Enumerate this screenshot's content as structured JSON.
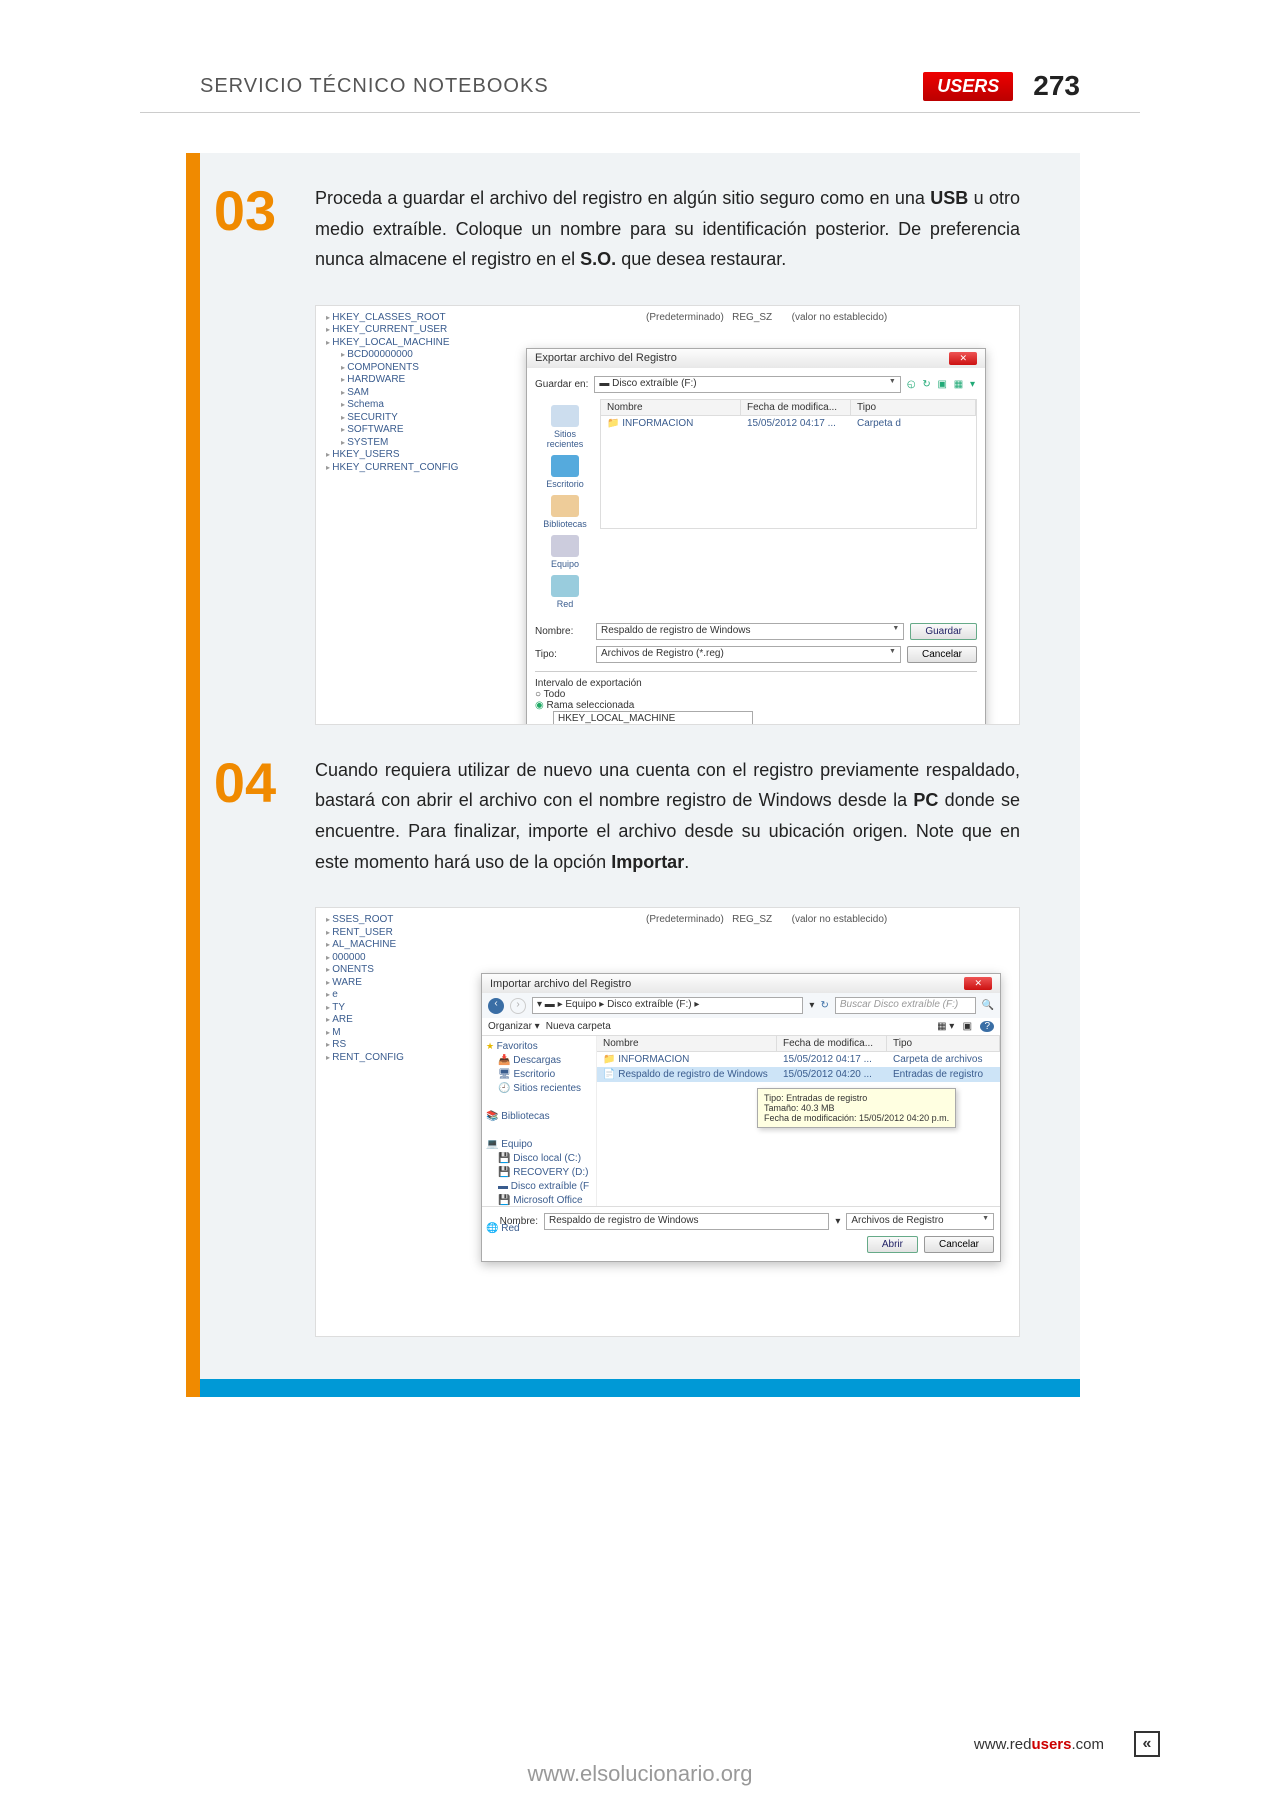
{
  "header": {
    "title": "SERVICIO TÉCNICO NOTEBOOKS",
    "brand": "USERS",
    "page_number": "273"
  },
  "steps": [
    {
      "num": "03",
      "text_parts": [
        "Proceda a guardar el archivo del registro en algún sitio seguro como en una ",
        "USB",
        " u otro medio extraíble. Coloque un nombre para su identificación posterior. De preferencia nunca almacene el registro en el ",
        "S.O.",
        " que desea restaurar."
      ]
    },
    {
      "num": "04",
      "text_parts": [
        "Cuando requiera utilizar de nuevo una cuenta con el registro previamente respaldado, bastará con abrir el archivo con el nombre registro de Windows desde la ",
        "PC",
        " donde se encuentre. Para finalizar, importe el archivo desde su ubicación origen. Note que en este momento hará uso de la opción ",
        "Importar",
        "."
      ]
    }
  ],
  "screenshot1": {
    "tree": [
      "HKEY_CLASSES_ROOT",
      "HKEY_CURRENT_USER",
      "HKEY_LOCAL_MACHINE",
      "BCD00000000",
      "COMPONENTS",
      "HARDWARE",
      "SAM",
      "Schema",
      "SECURITY",
      "SOFTWARE",
      "SYSTEM",
      "HKEY_USERS",
      "HKEY_CURRENT_CONFIG"
    ],
    "value_row": {
      "name": "(Predeterminado)",
      "type": "REG_SZ",
      "data": "(valor no establecido)"
    },
    "dialog_title": "Exportar archivo del Registro",
    "save_in_label": "Guardar en:",
    "save_in_value": "Disco extraíble (F:)",
    "toolbar_icons": "◵ ↻ ▣ ▦ ▾",
    "places": [
      "Sitios recientes",
      "Escritorio",
      "Bibliotecas",
      "Equipo",
      "Red"
    ],
    "list_headers": [
      "Nombre",
      "Fecha de modifica...",
      "Tipo"
    ],
    "list_row": {
      "name": "INFORMACION",
      "date": "15/05/2012 04:17 ...",
      "type": "Carpeta d"
    },
    "name_label": "Nombre:",
    "name_value": "Respaldo de registro de Windows",
    "type_label": "Tipo:",
    "type_value": "Archivos de Registro (*.reg)",
    "btn_save": "Guardar",
    "btn_cancel": "Cancelar",
    "scope_label": "Intervalo de exportación",
    "scope_all": "Todo",
    "scope_sel": "Rama seleccionada",
    "scope_branch": "HKEY_LOCAL_MACHINE"
  },
  "screenshot2": {
    "tree": [
      "SSES_ROOT",
      "RENT_USER",
      "AL_MACHINE",
      "000000",
      "ONENTS",
      "WARE",
      "e",
      "TY",
      "ARE",
      "M",
      "RS",
      "RENT_CONFIG"
    ],
    "value_row": {
      "name": "(Predeterminado)",
      "type": "REG_SZ",
      "data": "(valor no establecido)"
    },
    "dialog_title": "Importar archivo del Registro",
    "breadcrumb": "▾ ▬ ▸ Equipo ▸ Disco extraíble (F:) ▸",
    "search_placeholder": "Buscar Disco extraíble (F:)",
    "organize": "Organizar ▾",
    "new_folder": "Nueva carpeta",
    "nav_items": [
      "Favoritos",
      "Descargas",
      "Escritorio",
      "Sitios recientes",
      "",
      "Bibliotecas",
      "",
      "Equipo",
      "Disco local (C:)",
      "RECOVERY (D:)",
      "Disco extraíble (F",
      "Microsoft Office",
      "",
      "Red"
    ],
    "list_headers": [
      "Nombre",
      "Fecha de modifica...",
      "Tipo"
    ],
    "list_rows": [
      {
        "name": "INFORMACION",
        "date": "15/05/2012 04:17 ...",
        "type": "Carpeta de archivos"
      },
      {
        "name": "Respaldo de registro de Windows",
        "date": "15/05/2012 04:20 ...",
        "type": "Entradas de registro"
      }
    ],
    "tooltip": "Tipo: Entradas de registro\nTamaño: 40.3 MB\nFecha de modificación: 15/05/2012 04:20 p.m.",
    "name_label": "Nombre:",
    "name_value": "Respaldo de registro de Windows",
    "type_value": "Archivos de Registro",
    "btn_open": "Abrir",
    "btn_cancel": "Cancelar"
  },
  "footer": {
    "url_pre": "www.red",
    "url_bold": "users",
    "url_post": ".com",
    "back": "«"
  },
  "watermark": "www.elsolucionario.org"
}
